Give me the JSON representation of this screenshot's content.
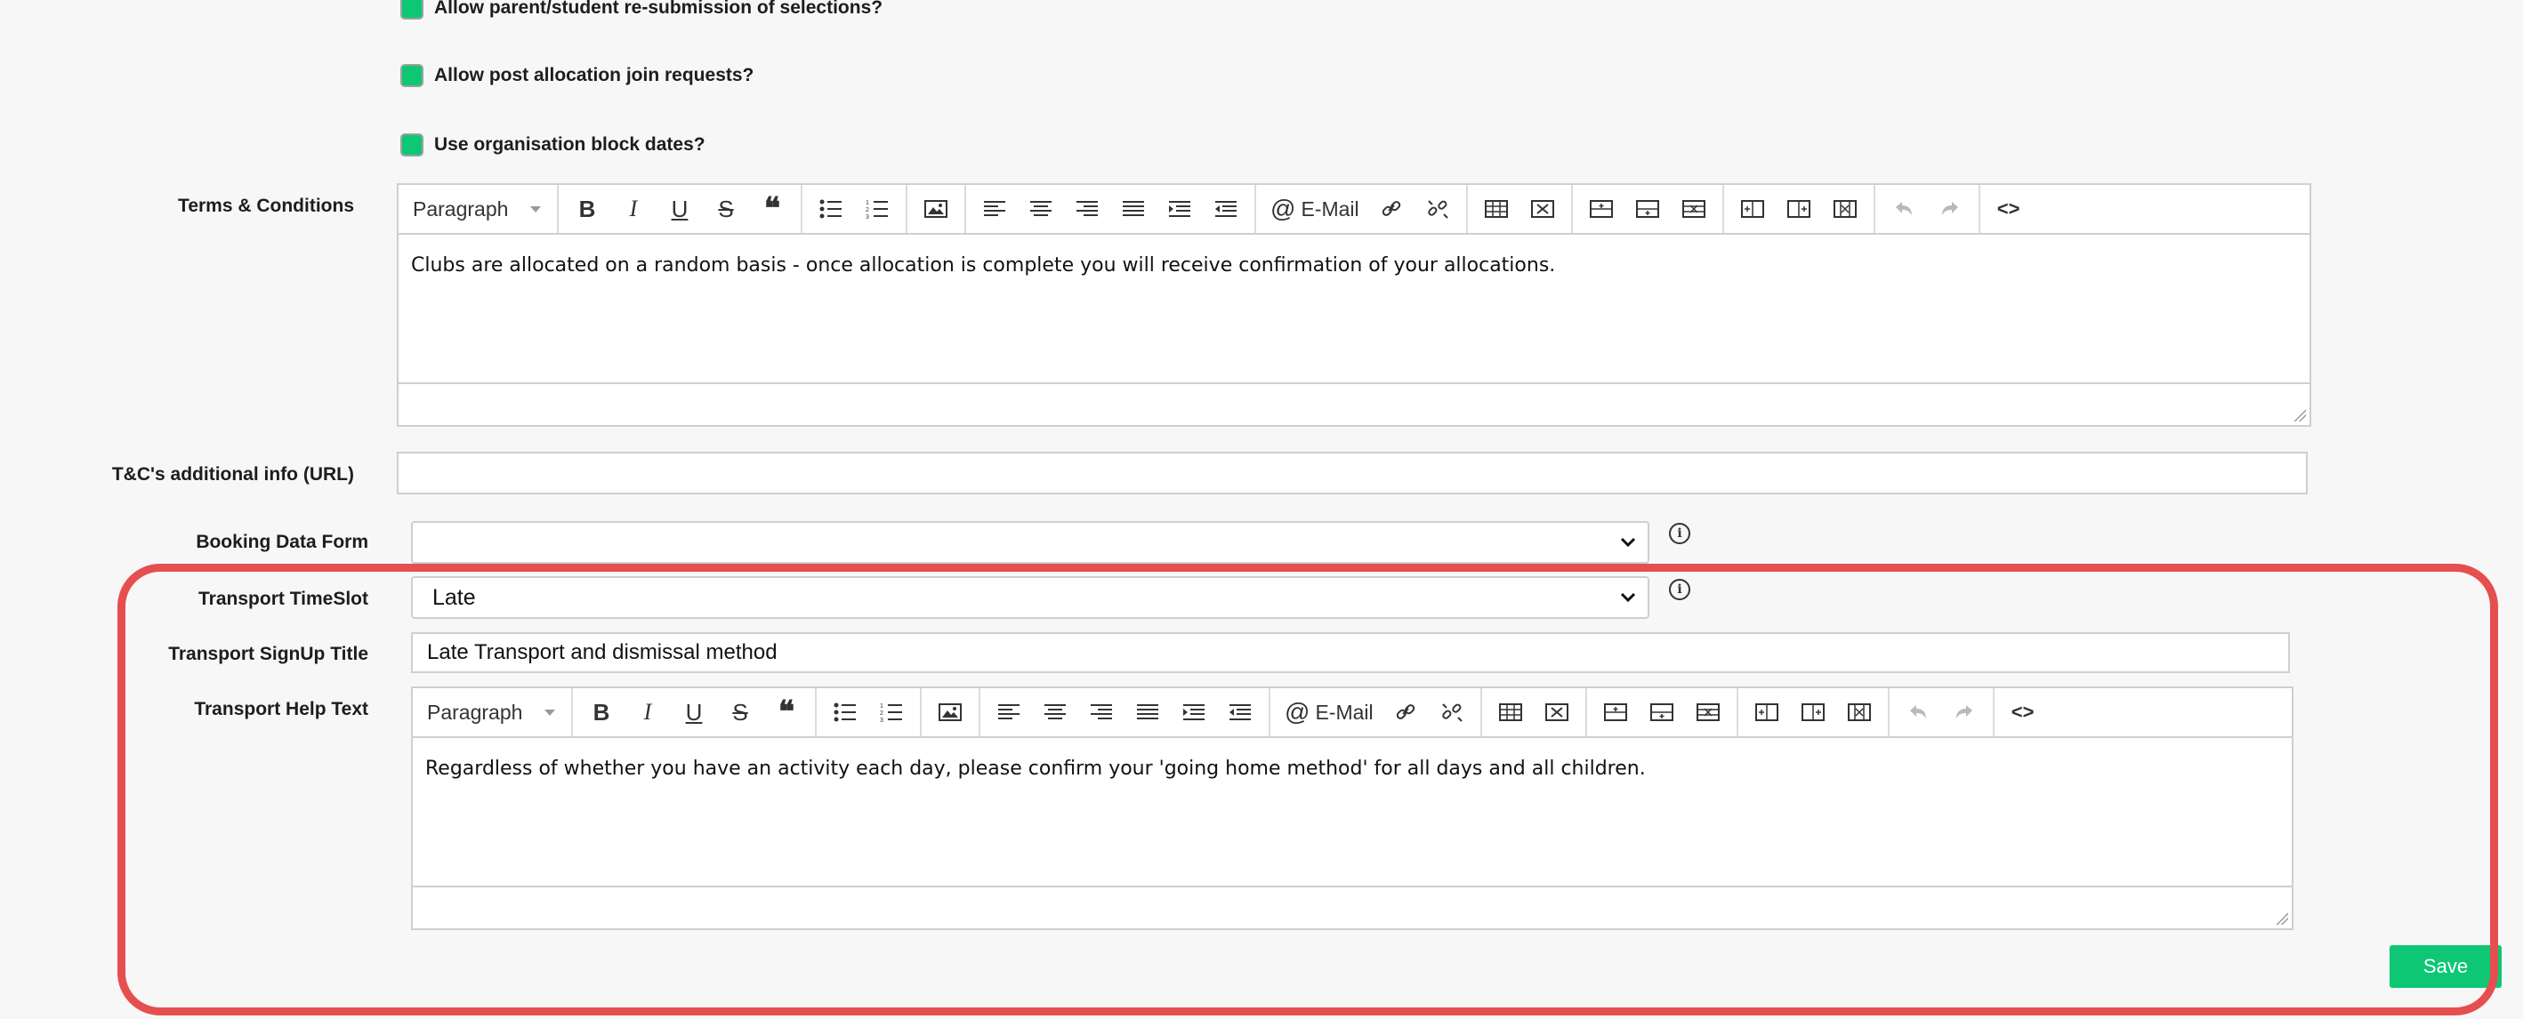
{
  "checkboxes": [
    {
      "label": "Allow parent/student re-submission of selections?",
      "checked": true
    },
    {
      "label": "Allow post allocation join requests?",
      "checked": true
    },
    {
      "label": "Use organisation block dates?",
      "checked": true
    }
  ],
  "terms": {
    "label": "Terms & Conditions",
    "format": "Paragraph",
    "content": "Clubs are allocated on a random basis - once allocation is complete you will receive confirmation of your allocations."
  },
  "tc_url": {
    "label": "T&C's additional info (URL)",
    "value": ""
  },
  "booking_form": {
    "label": "Booking Data Form",
    "value": ""
  },
  "transport": {
    "timeslot_label": "Transport TimeSlot",
    "timeslot_value": "Late",
    "signup_title_label": "Transport SignUp Title",
    "signup_title_value": "Late Transport and dismissal method",
    "help_label": "Transport Help Text",
    "help_format": "Paragraph",
    "help_content": "Regardless of whether you have an activity each day, please confirm your 'going home method' for all days and all children."
  },
  "toolbar": {
    "email_label": "E-Mail",
    "icons": {
      "bold": "B",
      "italic": "I",
      "underline": "U",
      "strike": "S",
      "quote": "❝",
      "code": "<>"
    }
  },
  "save_label": "Save",
  "colors": {
    "accent_green": "#0dc775",
    "highlight_red": "#e64f4f"
  }
}
